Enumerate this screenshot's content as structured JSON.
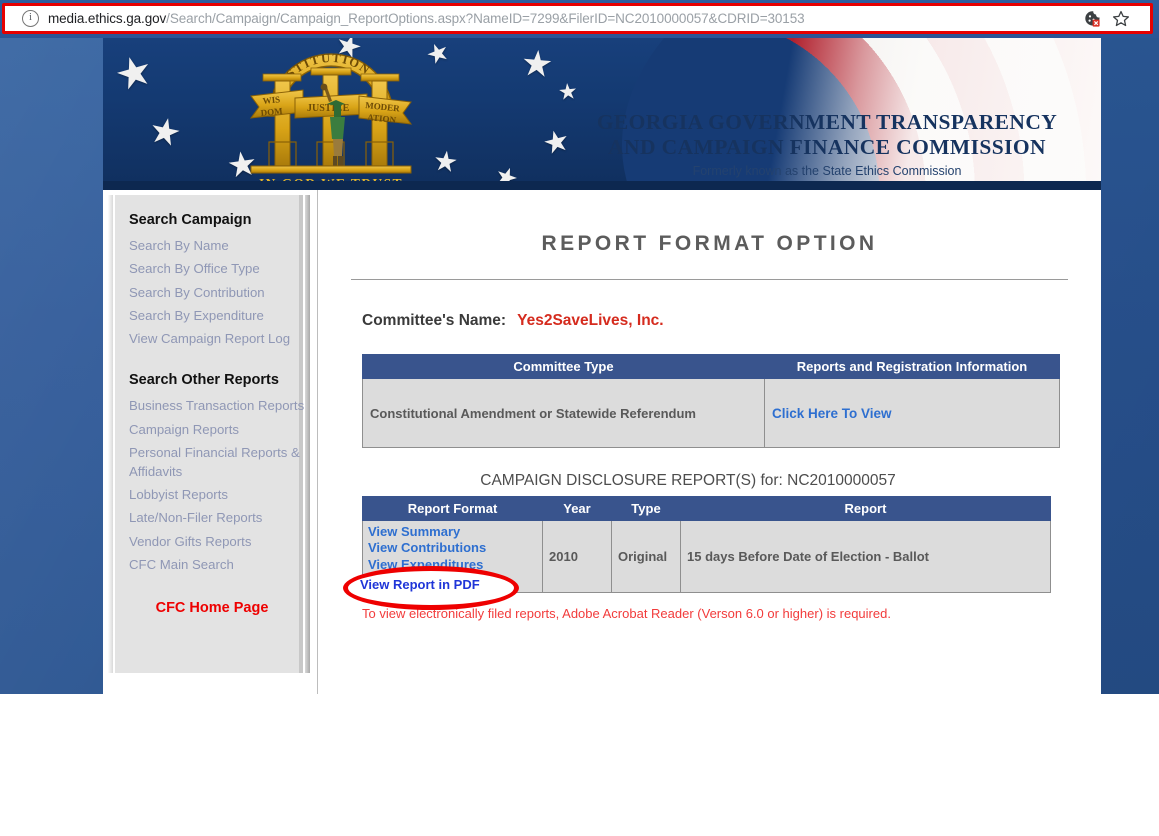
{
  "browser": {
    "url_host": "media.ethics.ga.gov",
    "url_path": "/Search/Campaign/Campaign_ReportOptions.aspx?NameID=7299&FilerID=NC2010000057&CDRID=30153",
    "info_glyph": "i",
    "icons": [
      "cookie-blocked-icon",
      "bookmark-star-icon"
    ]
  },
  "banner": {
    "title_line1": "GEORGIA GOVERNMENT TRANSPARENCY",
    "title_line2": "AND CAMPAIGN FINANCE COMMISSION",
    "subtitle": "Formerly known as the State Ethics Commission",
    "seal": {
      "arch_text": "CONSTITUTION",
      "pillar1": "WIS",
      "pillar1b": "DOM",
      "pillar2": "JUSTICE",
      "pillar3": "MODER",
      "pillar3b": "ATION",
      "motto": "IN GOD WE TRUST"
    }
  },
  "sidebar": {
    "group1_heading": "Search Campaign",
    "group1_items": [
      "Search By Name",
      "Search By Office Type",
      "Search By Contribution",
      "Search By Expenditure",
      "View Campaign Report Log"
    ],
    "group2_heading": "Search Other Reports",
    "group2_items": [
      "Business Transaction Reports",
      "Campaign Reports",
      "Personal Financial Reports & Affidavits",
      "Lobbyist Reports",
      "Late/Non-Filer Reports",
      "Vendor Gifts Reports",
      "CFC Main Search"
    ],
    "home_link": "CFC Home Page"
  },
  "main": {
    "page_title": "REPORT FORMAT OPTION",
    "committee_label": "Committee's Name:",
    "committee_name": "Yes2SaveLives, Inc.",
    "committee_table": {
      "headers": [
        "Committee Type",
        "Reports and Registration Information"
      ],
      "rows": [
        {
          "type": "Constitutional Amendment or Statewide Referendum",
          "link": "Click Here To View"
        }
      ]
    },
    "disclosure_heading": "CAMPAIGN DISCLOSURE REPORT(S) for: NC2010000057",
    "report_table": {
      "headers": [
        "Report Format",
        "Year",
        "Type",
        "Report"
      ],
      "rows": [
        {
          "formats": [
            "View Summary",
            "View Contributions",
            "View Expenditures",
            "View Report in PDF"
          ],
          "year": "2010",
          "type": "Original",
          "report": "15 days Before Date of Election - Ballot"
        }
      ]
    },
    "footer_note": "To view electronically filed reports, Adobe Acrobat Reader (Verson 6.0 or higher) is required.",
    "highlighted_link": "View Report in PDF"
  },
  "colors": {
    "table_header_blue": "#39548d",
    "link_blue": "#2e6fd0",
    "accent_red": "#ee0000",
    "committee_red": "#d52b1e",
    "page_blue": "#2a5596"
  }
}
